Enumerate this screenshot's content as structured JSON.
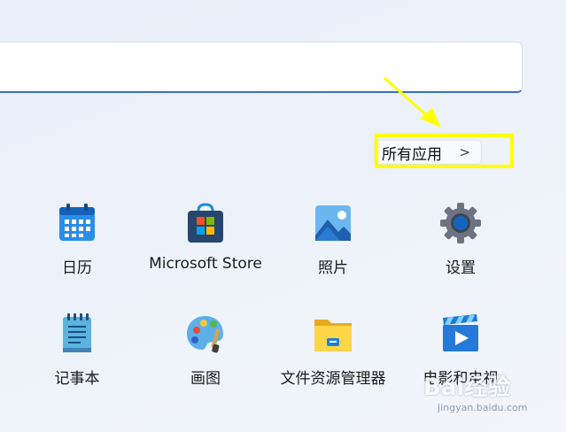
{
  "search": {
    "placeholder": ""
  },
  "all_apps": {
    "label": "所有应用",
    "chevron": ">"
  },
  "apps": [
    {
      "label": "日历",
      "icon": "calendar-icon"
    },
    {
      "label": "Microsoft Store",
      "icon": "store-icon"
    },
    {
      "label": "照片",
      "icon": "photos-icon"
    },
    {
      "label": "设置",
      "icon": "settings-gear-icon"
    },
    {
      "label": "记事本",
      "icon": "notepad-icon"
    },
    {
      "label": "画图",
      "icon": "paint-palette-icon"
    },
    {
      "label": "文件资源管理器",
      "icon": "folder-icon"
    },
    {
      "label": "电影和电视",
      "icon": "video-play-icon"
    }
  ],
  "annotation": {
    "highlight_color": "#ffff00"
  },
  "watermark": {
    "brand": "Bai经验",
    "url": "jingyan.baidu.com"
  }
}
